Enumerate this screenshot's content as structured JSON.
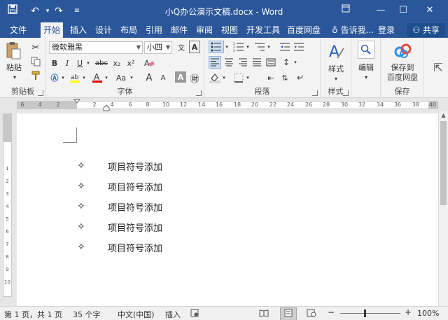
{
  "window": {
    "title": "小Q办公演示文稿.docx - Word"
  },
  "tabs": [
    {
      "label": "文件"
    },
    {
      "label": "开始"
    },
    {
      "label": "插入"
    },
    {
      "label": "设计"
    },
    {
      "label": "布局"
    },
    {
      "label": "引用"
    },
    {
      "label": "邮件"
    },
    {
      "label": "审阅"
    },
    {
      "label": "视图"
    },
    {
      "label": "开发工具"
    },
    {
      "label": "百度网盘"
    }
  ],
  "tellme": "告诉我...",
  "login": "登录",
  "share": "共享",
  "ribbon": {
    "clipboard": {
      "label": "剪贴板",
      "paste": "粘贴"
    },
    "font": {
      "label": "字体",
      "font_name": "微软雅黑",
      "font_size": "小四",
      "bold": "B",
      "italic": "I",
      "underline": "U",
      "strike": "abc",
      "subscript": "x₂",
      "superscript": "x²",
      "change_case": "Aa",
      "grow": "A",
      "shrink": "A"
    },
    "paragraph": {
      "label": "段落"
    },
    "styles": {
      "label": "样式",
      "button": "样式"
    },
    "editing": {
      "button": "编辑"
    },
    "save": {
      "label": "保存",
      "button_line1": "保存到",
      "button_line2": "百度网盘"
    }
  },
  "ruler": {
    "ticks": [
      "6",
      "4",
      "2",
      "2",
      "4",
      "6",
      "8",
      "10",
      "12",
      "14",
      "16",
      "18",
      "20",
      "22",
      "24",
      "26",
      "28",
      "30",
      "32",
      "34",
      "36",
      "38",
      "40"
    ],
    "vticks": [
      "1",
      "2",
      "3",
      "4",
      "5",
      "6",
      "7",
      "8",
      "9",
      "10"
    ]
  },
  "document": {
    "bullet_symbol": "✧",
    "items": [
      "项目符号添加",
      "项目符号添加",
      "项目符号添加",
      "项目符号添加",
      "项目符号添加"
    ]
  },
  "status": {
    "page": "第 1 页，共 1 页",
    "words": "35 个字",
    "language": "中文(中国)",
    "mode": "插入",
    "zoom": "100%"
  }
}
